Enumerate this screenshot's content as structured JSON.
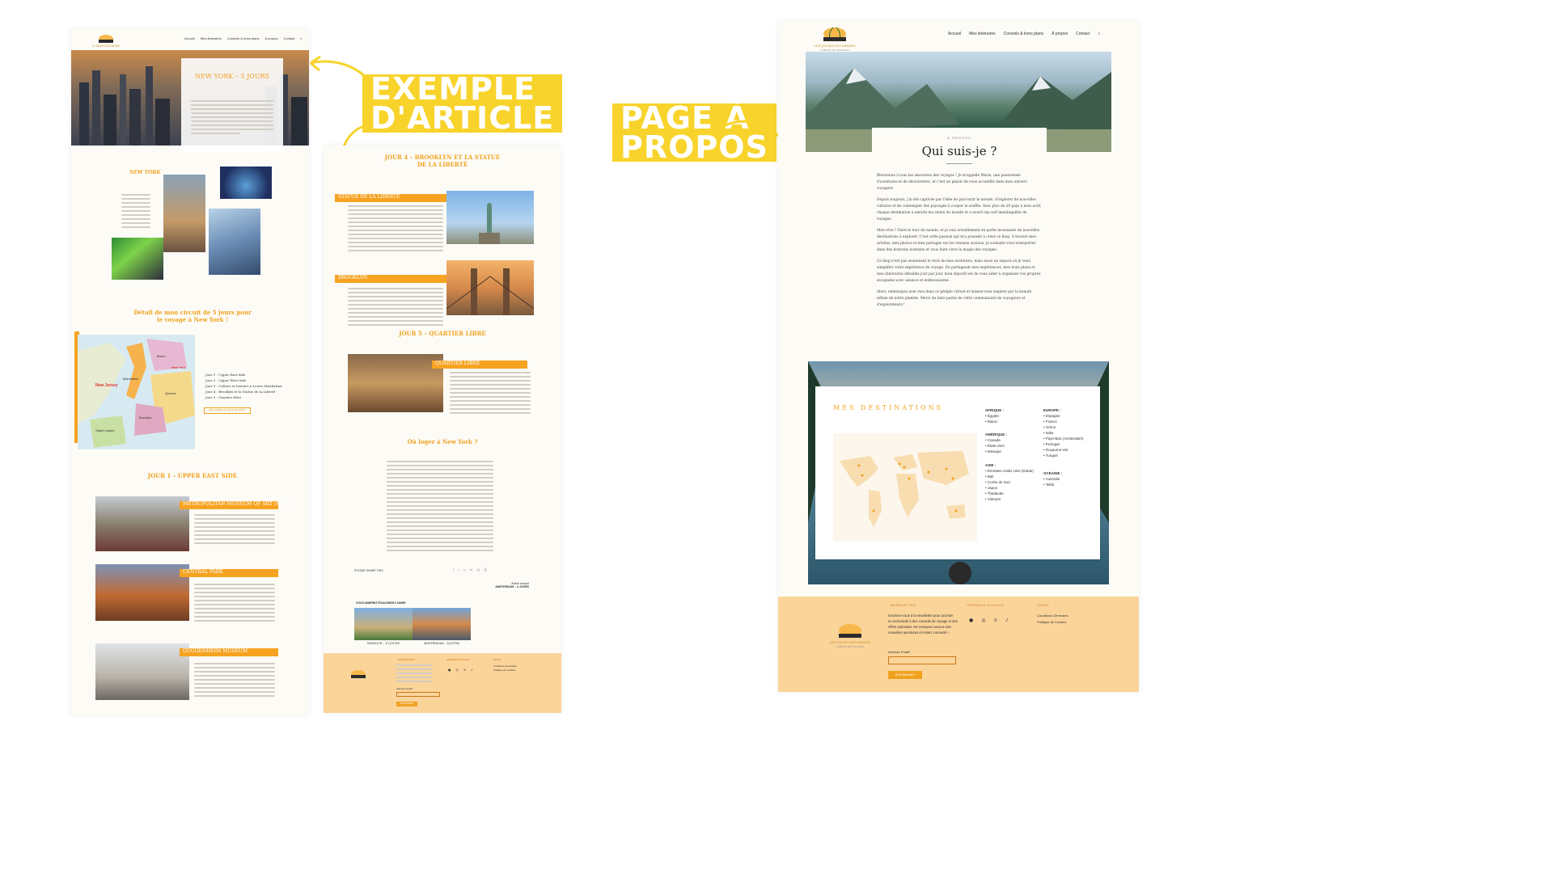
{
  "annotations": {
    "article_label": [
      "EXEMPLE",
      "D'ARTICLE"
    ],
    "about_label": [
      "PAGE À",
      "PROPOS"
    ],
    "arrow_color": "#f8d32b"
  },
  "article_page": {
    "nav": [
      "Accueil",
      "Mes itinéraires",
      "Conseils & bons plans",
      "À propos",
      "Contact"
    ],
    "hero_title": "NEW YORK – 5 JOURS",
    "intro_heading": "NEW YORK",
    "circuit_heading_1": "Détail de mon circuit de 5 jours pour",
    "circuit_heading_2": "le voyage à New York !",
    "map_labels": [
      "Manhattan",
      "Bronx",
      "Queens",
      "Brooklyn",
      "Staten Island",
      "New Jersey",
      "New York"
    ],
    "days": [
      "Jour 1 : Upper East Side",
      "Jour 2 : Upper West Side",
      "Jour 3 : Culture et histoire à Lower Manhattan",
      "Jour 4 : Brooklyn et la Statue de la Liberté",
      "Jour 5 : Quartier libre"
    ],
    "circuit_button": "DÉCOUVREZ LE CIRCUIT EN DÉTAIL",
    "day1_heading": "JOUR 1 – UPPER EAST SIDE",
    "sections": [
      "METROPOLITAN MUSEUM OF ART (MET)",
      "CENTRAL PARK",
      "GUGGENHEIM MUSEUM"
    ]
  },
  "article_continued": {
    "day4_heading_1": "JOUR 4 – BROOKLYN ET LA STATUE",
    "day4_heading_2": "DE LA LIBERTÉ",
    "sections": [
      "STATUE DE LA LIBERTÉ",
      "BROOKLYN",
      "QUARTIER LIBRE"
    ],
    "day5_heading": "JOUR 5 – QUARTIER LIBRE",
    "lodging_heading": "Où loger à New York ?",
    "share_label": "PLEASE SHARE THIS",
    "next_label": "Article suivant",
    "next_title": "AMSTERDAM – 4 JOURS",
    "related_label": "VOUS AIMEREZ ÉGALEMENT AIMER",
    "related": [
      {
        "title": "MEXIQUE – 10 JOURS"
      },
      {
        "title": "AMSTERDAM – 4 JOURS"
      }
    ],
    "footer": {
      "newsletter": "NEWSLETTER",
      "socials": "RÉSEAUX SOCIAUX",
      "legal": "LÉGAL",
      "legal_links": [
        "Conditions Générales",
        "Politique de Cookies"
      ],
      "email_label": "Adresse Email*",
      "button": "JE M'ABONNE !"
    }
  },
  "about_page": {
    "nav": [
      "Accueil",
      "Mes itinéraires",
      "Conseils & bons plans",
      "À propos",
      "Contact"
    ],
    "logo_text": "LES JOLIES ESCAPADES",
    "logo_sub": "CARNET DE VOYAGES",
    "kicker": "À PROPOS",
    "title": "Qui suis-je ?",
    "paragraphs": [
      "Bienvenue à tous les amoureux des voyages ! Je m'appelle Marie, une passionnée d'aventures et de découvertes, et c'est un plaisir de vous accueillir dans mon univers voyageur.",
      "Depuis toujours, j'ai été captivée par l'idée de parcourir le monde, d'explorer de nouvelles cultures et de contempler des paysages à couper le souffle. Avec plus de 20 pays à mon actif, chaque destination a enrichi ma vision du monde et a nourri ma soif inextinguible de voyages.",
      "Mon rêve ? Faire le tour du monde, et je suis actuellement en quête incessante de nouvelles destinations à explorer. C'est cette passion qui m'a poussée à créer ce blog. À travers mes articles, mes photos et mes partages sur les réseaux sociaux, je souhaite vous transporter dans des horizons lointains et vous faire vivre la magie des voyages.",
      "Ce blog n'est pas seulement le récit de mes aventures, mais aussi un espace où je veux simplifier votre expérience de voyage. En partageant mes expériences, mes bons plans et mes itinéraires détaillés jour par jour, mon objectif est de vous aider à organiser vos propres escapades avec aisance et enthousiasme.",
      "Alors, embarquez avec moi dans ce périple virtuel et laissez-vous inspirer par la beauté infinie de notre planète. Merci de faire partie de cette communauté de voyageurs et d'explorateurs !"
    ],
    "destinations_title": "MES DESTINATIONS",
    "regions": [
      {
        "name": "AFRIQUE :",
        "items": [
          "Égypte",
          "Maroc"
        ]
      },
      {
        "name": "AMÉRIQUE :",
        "items": [
          "Canada",
          "États-Unis",
          "Mexique"
        ]
      },
      {
        "name": "ASIE :",
        "items": [
          "Émirates Arabs Unis (Dubaï)",
          "Bali",
          "Corée du Sud",
          "Japon",
          "Thaïlande",
          "Vietnam"
        ]
      },
      {
        "name": "EUROPE :",
        "items": [
          "Espagne",
          "France",
          "Grèce",
          "Italie",
          "Pays-Bas (Amsterdam)",
          "Portugal",
          "Royaume-Uni",
          "Turquie"
        ]
      },
      {
        "name": "OCÉANIE :",
        "items": [
          "Australie",
          "Tahiti"
        ]
      }
    ],
    "footer": {
      "newsletter": "NEWSLETTER",
      "newsletter_text": "Inscrivez-vous à la newsletter pour accéder en exclusivité à des conseils de voyage et des offres spéciales. Ne manquez aucune des nouvelles aventures et restez connecté !",
      "socials": "RÉSEAUX SOCIAUX",
      "legal": "LÉGAL",
      "legal_links": [
        "Conditions Générales",
        "Politique de Cookies"
      ],
      "email_label": "Adresse Email*",
      "button": "JE M'ABONNE !"
    }
  }
}
